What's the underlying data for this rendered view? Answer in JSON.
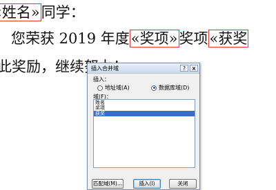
{
  "document": {
    "line1": {
      "field_name": "«姓名»",
      "text_after": "同学："
    },
    "line2": {
      "text_before": "您荣获  2019  年度",
      "field_award_item": "«奖项»",
      "text_middle": "奖项",
      "field_award": "«获奖"
    },
    "line3": {
      "text": "此奖励，继续努力！"
    }
  },
  "dialog": {
    "title": "插入合并域",
    "help_label": "?",
    "close_label": "×",
    "insert_label": "插入：",
    "radio_address": "地址域(A)",
    "radio_database": "数据库域(D)",
    "fields_label": "域(F)：",
    "fields": [
      "姓名",
      "奖项",
      "获奖"
    ],
    "selected_field": "获奖",
    "match_fields_label": "匹配域(M)...",
    "insert_button": "插入(I)",
    "close_button": "关闭"
  },
  "colors": {
    "merge_field_box": "#e23a32",
    "selection": "#3b6cc4"
  }
}
